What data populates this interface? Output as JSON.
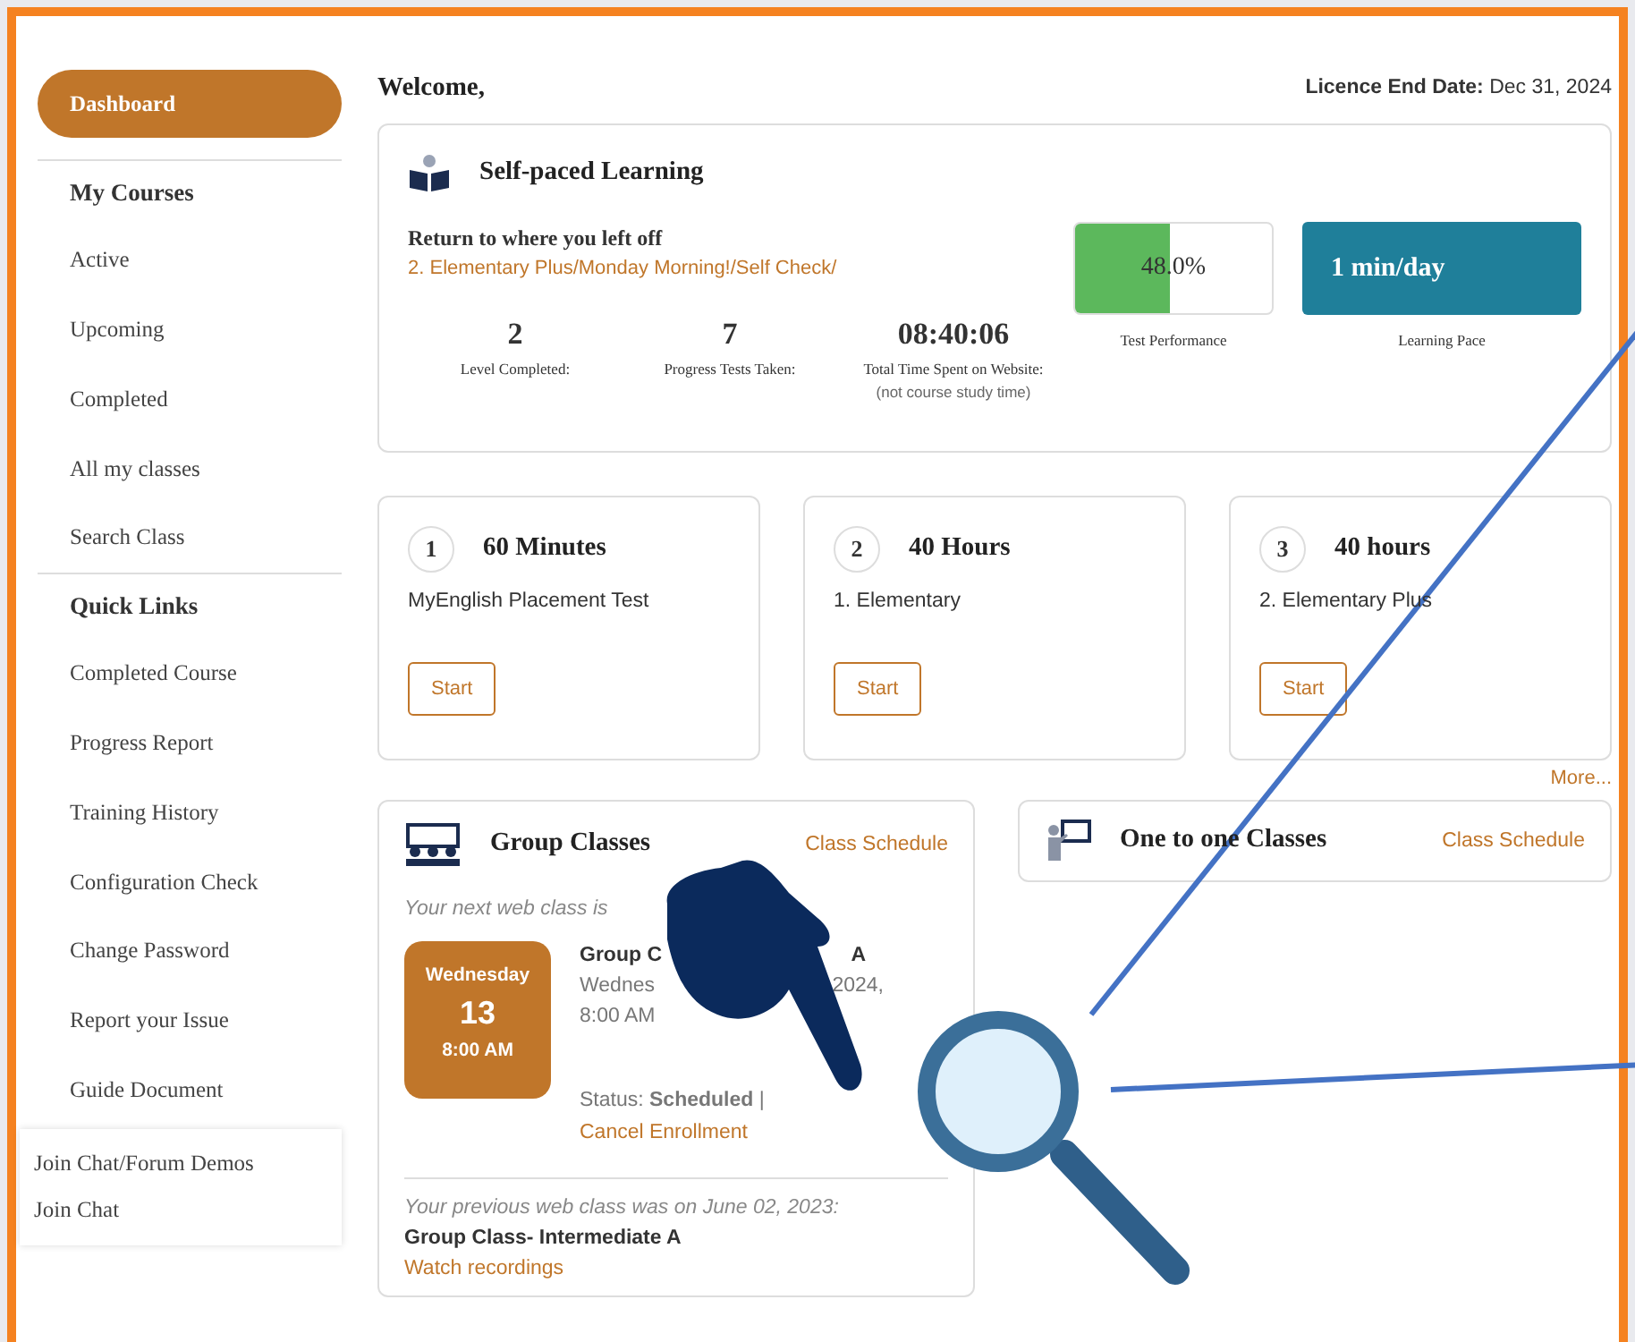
{
  "sidebar": {
    "items": [
      {
        "kind": "pill",
        "label": "Dashboard",
        "selected": true
      },
      {
        "kind": "heading",
        "label": "My Courses"
      },
      {
        "kind": "link",
        "label": "Active",
        "selected": false
      },
      {
        "kind": "link",
        "label": "Upcoming",
        "selected": false
      },
      {
        "kind": "link",
        "label": "Completed",
        "selected": false
      },
      {
        "kind": "link",
        "label": "All my classes",
        "selected": false
      },
      {
        "kind": "link",
        "label": "Search Class",
        "selected": false
      },
      {
        "kind": "heading",
        "label": "Quick Links"
      },
      {
        "kind": "link",
        "label": "Completed Course",
        "selected": false
      },
      {
        "kind": "link",
        "label": "Progress Report",
        "selected": false
      },
      {
        "kind": "link",
        "label": "Training History",
        "selected": false
      },
      {
        "kind": "link",
        "label": "Configuration Check",
        "selected": false
      },
      {
        "kind": "link",
        "label": "Change Password",
        "selected": false
      },
      {
        "kind": "link",
        "label": "Report your Issue",
        "selected": false
      },
      {
        "kind": "link",
        "label": "Guide Document",
        "selected": false
      }
    ],
    "popup_items": [
      "Join Chat/Forum Demos",
      "Join Chat"
    ]
  },
  "header": {
    "welcome": "Welcome,",
    "licence_label": "Licence End Date:",
    "licence_date": "Dec 31, 2024"
  },
  "self_paced": {
    "title": "Self-paced Learning",
    "resume_heading": "Return to where you left off",
    "resume_link": "2. Elementary Plus/Monday Morning!/Self Check/",
    "stats": [
      {
        "value": "2",
        "label": "Level Completed:"
      },
      {
        "value": "7",
        "label": "Progress Tests Taken:"
      },
      {
        "value": "08:40:06",
        "label": "Total Time Spent on Website:",
        "note": "(not course study time)"
      }
    ],
    "performance": {
      "reading": "48.0%",
      "level": 0.48,
      "label": "Test Performance"
    },
    "pace": {
      "reading": "1 min/day",
      "label": "Learning Pace"
    }
  },
  "courses": [
    {
      "number": "1",
      "duration": "60 Minutes",
      "name": "MyEnglish Placement Test",
      "button": "Start"
    },
    {
      "number": "2",
      "duration": "40 Hours",
      "name": "1. Elementary",
      "button": "Start"
    },
    {
      "number": "3",
      "duration": "40 hours",
      "name": "2. Elementary Plus",
      "button": "Start"
    }
  ],
  "more_link": "More...",
  "group_classes": {
    "title": "Group Classes",
    "schedule_link": "Class Schedule",
    "next_intro": "Your next web class is",
    "date_badge": {
      "day": "Wednesday",
      "date": "13",
      "time": "8:00 AM"
    },
    "class_title_parts": [
      "Group C",
      "A"
    ],
    "class_date_parts": [
      "Wednes",
      "2024,"
    ],
    "class_time": "8:00 AM",
    "status": "Status: **Scheduled** |",
    "cancel_link": "Cancel Enrollment",
    "previous_intro": "Your previous web class was on June 02, 2023:",
    "previous_class": "Group Class- Intermediate A",
    "recordings_link": "Watch recordings"
  },
  "one_to_one": {
    "title": "One to one Classes",
    "schedule_link": "Class Schedule"
  }
}
